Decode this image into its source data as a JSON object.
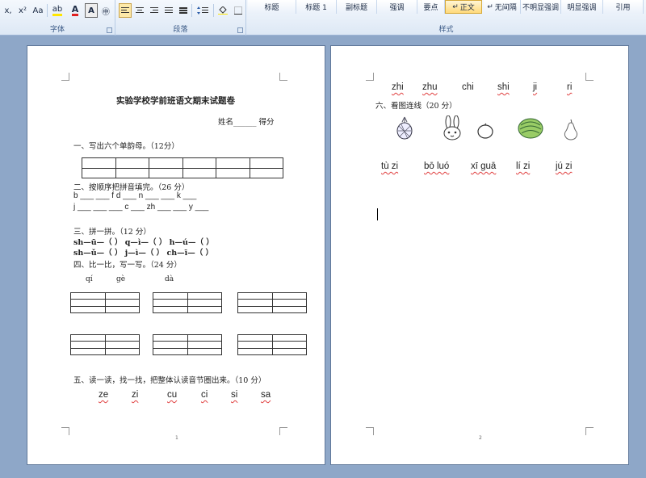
{
  "ribbon": {
    "font_group": {
      "label": "字体",
      "buttons": [
        "x,",
        "x²",
        "Aa",
        "ab",
        "A",
        "A",
        "㊥"
      ]
    },
    "paragraph_group": {
      "label": "段落"
    },
    "styles_group": {
      "label": "样式",
      "styles": [
        "标题",
        "标题 1",
        "副标题",
        "强调",
        "要点",
        "正文",
        "无间隔",
        "不明显强调",
        "明显强调",
        "引用"
      ],
      "selected": "正文"
    },
    "colors": {
      "highlight": "#ffe600",
      "font_color": "#e02020"
    }
  },
  "page1": {
    "title": "实验学校学前班语文期末试题卷",
    "name_score": "姓名______ 得分",
    "q1": "一、写出六个单韵母。（12分）",
    "q2": "二、按顺序把拼音填完。（26 分）",
    "q2_row1": "b ___   ___   f   d  ___   n   ___  ___   k   ___",
    "q2_row2": "j ___   ___  ___   c  ___   zh ___  ___   y ___",
    "q3": "三、拼一拼。（12 分）",
    "q3_row1": "sh—ū—（    ）   q—ì—（    ）   h—ú—（    ）",
    "q3_row2": "sh—ǔ—（    ）   j—ì—（    ）   ch—ī—（    ）",
    "q4": "四、比一比，写一写。（24 分）",
    "q4_hints": [
      "qí",
      "gè",
      "dà"
    ],
    "q5": "五、读一读，找一找，把整体认读音节圈出来。（10 分）",
    "q5_syllables": [
      "ze",
      "zi",
      "cu",
      "ci",
      "si",
      "sa"
    ],
    "page_number": "1"
  },
  "page2": {
    "top_syllables": [
      "zhi",
      "zhu",
      "chi",
      "shi",
      "ji",
      "ri"
    ],
    "q6": "六、看图连线（20 分）",
    "pictures": [
      "pineapple-icon",
      "rabbit-icon",
      "orange-icon",
      "watermelon-icon",
      "pear-icon"
    ],
    "words": [
      "tù zi",
      "bō luó",
      "xī guā",
      "lí zi",
      "jú zi"
    ],
    "page_number": "2"
  }
}
